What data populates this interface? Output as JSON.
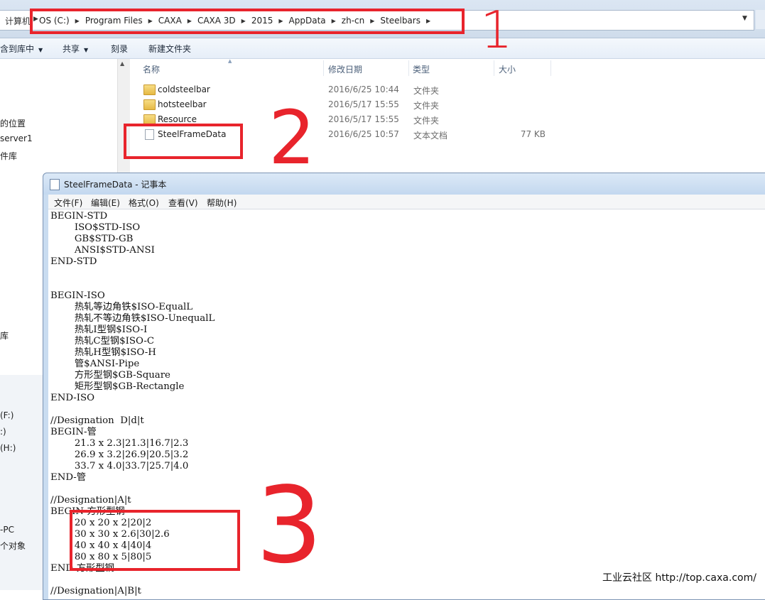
{
  "explorer": {
    "breadcrumb_lead": "计算机",
    "breadcrumb": [
      "OS (C:)",
      "Program Files",
      "CAXA",
      "CAXA 3D",
      "2015",
      "AppData",
      "zh-cn",
      "Steelbars"
    ],
    "toolbar": {
      "include": "含到库中",
      "share": "共享",
      "burn": "刻录",
      "new_folder": "新建文件夹"
    },
    "nav_items": [
      "的位置",
      "server1",
      "件库",
      "库",
      "(F:)",
      ":)",
      "(H:)",
      "-PC",
      "个对象"
    ],
    "columns": {
      "name": "名称",
      "date": "修改日期",
      "type": "类型",
      "size": "大小"
    },
    "files": [
      {
        "name": "coldsteelbar",
        "date": "2016/6/25 10:44",
        "type": "文件夹",
        "size": "",
        "icon": "folder-icon"
      },
      {
        "name": "hotsteelbar",
        "date": "2016/5/17 15:55",
        "type": "文件夹",
        "size": "",
        "icon": "folder-icon"
      },
      {
        "name": "Resource",
        "date": "2016/5/17 15:55",
        "type": "文件夹",
        "size": "",
        "icon": "folder-icon"
      },
      {
        "name": "SteelFrameData",
        "date": "2016/6/25 10:57",
        "type": "文本文档",
        "size": "77 KB",
        "icon": "text-file-icon"
      }
    ]
  },
  "notepad": {
    "title": "SteelFrameData - 记事本",
    "menu": [
      "文件(F)",
      "编辑(E)",
      "格式(O)",
      "查看(V)",
      "帮助(H)"
    ],
    "content": "BEGIN-STD\n        ISO$STD-ISO\n        GB$STD-GB\n        ANSI$STD-ANSI\nEND-STD\n\n\nBEGIN-ISO\n        热轧等边角铁$ISO-EqualL\n        热轧不等边角铁$ISO-UnequalL\n        热轧I型钢$ISO-I\n        热轧C型钢$ISO-C\n        热轧H型钢$ISO-H\n        管$ANSI-Pipe\n        方形型钢$GB-Square\n        矩形型钢$GB-Rectangle\nEND-ISO\n\n//Designation  D|d|t\nBEGIN-管\n        21.3 x 2.3|21.3|16.7|2.3\n        26.9 x 3.2|26.9|20.5|3.2\n        33.7 x 4.0|33.7|25.7|4.0\nEND-管\n\n//Designation|A|t\nBEGIN-方形型钢\n        20 x 20 x 2|20|2\n        30 x 30 x 2.6|30|2.6\n        40 x 40 x 4|40|4\n        80 x 80 x 5|80|5\nEND-方形型钢\n\n//Designation|A|B|t"
  },
  "annotations": {
    "mark1": "1",
    "mark2": "2",
    "mark3": "3",
    "color": "#e8242c"
  },
  "watermark": "工业云社区 http://top.caxa.com/"
}
